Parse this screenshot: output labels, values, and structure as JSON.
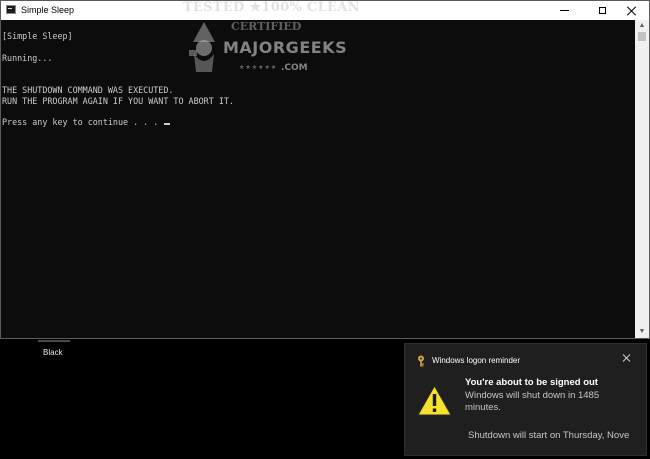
{
  "window": {
    "title": "Simple Sleep",
    "app_icon": "console-icon",
    "controls": {
      "minimize_icon": "minimize-icon",
      "maximize_icon": "maximize-icon",
      "close_icon": "close-icon"
    }
  },
  "console": {
    "lines": [
      "[Simple Sleep]",
      "",
      "Running...",
      "",
      "",
      "THE SHUTDOWN COMMAND WAS EXECUTED.",
      "RUN THE PROGRAM AGAIN IF YOU WANT TO ABORT IT.",
      "",
      "Press any key to continue . . . "
    ],
    "text_color": "#cccccc",
    "background": "#0c0c0c"
  },
  "watermark": {
    "top_text": "TESTED ★100% CLEAN",
    "certified_text": "CERTIFIED",
    "brand": "MAJORGEEKS",
    "stars": "★★★★★★",
    "domain": ".COM"
  },
  "desktop": {
    "label": "Black"
  },
  "toast": {
    "app_icon": "key-icon",
    "app_name": "Windows logon reminder",
    "close_icon": "close-icon",
    "warning_icon": "warning-icon",
    "heading": "You're about to be signed out",
    "body": "Windows will shut down in 1485 minutes.",
    "footer": "Shutdown will start on Thursday, Nove",
    "warning_color": "#f6e12b"
  }
}
